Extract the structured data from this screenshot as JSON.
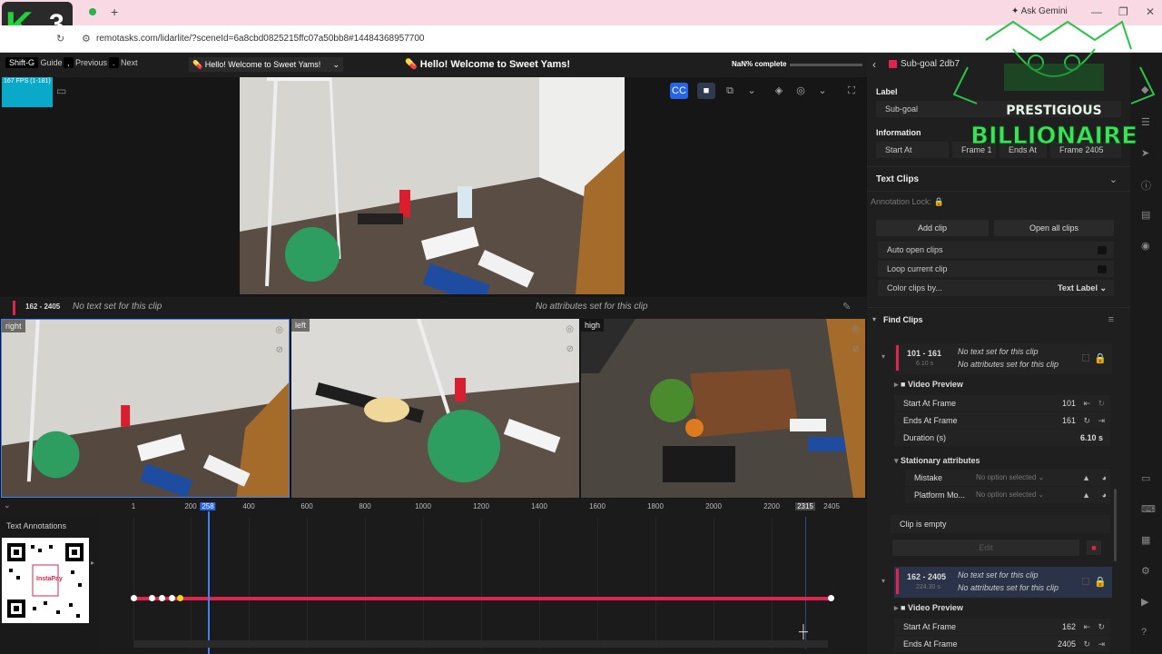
{
  "browser": {
    "url": "remotasks.com/lidarlite/?sceneId=6a8cbd0825215ffc07a50bb8#14484368957700",
    "ask_gemini": "Ask Gemini",
    "new_tab": "+",
    "logo_number": "3"
  },
  "topbar": {
    "shortcut_key": "Shift-G",
    "guide": "Guide",
    "previous": "Previous",
    "next": "Next",
    "task_title_small": "Hello! Welcome to Sweet Yams!",
    "task_title": "Hello! Welcome to Sweet Yams!",
    "progress": "NaN% complete"
  },
  "fps": "167 FPS (1-181)",
  "clip_bar": {
    "range": "162 - 2405",
    "text_status": "No text set for this clip",
    "attr_status": "No attributes set for this clip"
  },
  "cameras": [
    {
      "label": "right"
    },
    {
      "label": "left"
    },
    {
      "label": "high"
    }
  ],
  "timeline": {
    "section_label": "Text Annotations",
    "ticks": [
      "1",
      "200",
      "258",
      "400",
      "600",
      "800",
      "1000",
      "1200",
      "1400",
      "1600",
      "1800",
      "2000",
      "2200",
      "2315",
      "2405"
    ],
    "current_frame": "258",
    "end_marker": "2315"
  },
  "panel": {
    "header_title": "Sub-goal 2db7",
    "label_heading": "Label",
    "label_value": "Sub-goal",
    "info_heading": "Information",
    "start_at": "Start At",
    "start_frame": "Frame 1",
    "ends_at": "Ends At",
    "end_frame": "Frame 2405",
    "text_clips": "Text Clips",
    "annotation_lock": "Annotation Lock:",
    "add_clip": "Add clip",
    "open_all_clips": "Open all clips",
    "auto_open": "Auto open clips",
    "loop_current": "Loop current clip",
    "color_clips_by": "Color clips by...",
    "color_value": "Text Label",
    "find_clips": "Find Clips",
    "clip1": {
      "range": "101 - 161",
      "duration": "6.10 s",
      "no_text": "No text set for this clip",
      "no_attr": "No attributes set for this clip",
      "video_preview": "Video Preview",
      "start_label": "Start At Frame",
      "start_val": "101",
      "end_label": "Ends At Frame",
      "end_val": "161",
      "dur_label": "Duration (s)",
      "dur_val": "6.10 s",
      "stationary": "Stationary attributes",
      "mistake": "Mistake",
      "platform": "Platform Mo...",
      "no_option": "No option selected",
      "empty": "Clip is empty",
      "edit": "Edit"
    },
    "clip2": {
      "range": "162 - 2405",
      "duration": "224.30 s",
      "no_text": "No text set for this clip",
      "no_attr": "No attributes set for this clip",
      "video_preview": "Video Preview",
      "start_label": "Start At Frame",
      "start_val": "162",
      "end_label": "Ends At Frame",
      "end_val": "2405"
    }
  },
  "overlay": {
    "line1": "PRESTIGIOUS",
    "line2": "BILLIONAIRE"
  },
  "qr_text": "InstaPay",
  "colors": {
    "accent": "#e0244d",
    "playhead": "#3b82f6",
    "browser_tab_bg": "#f9d9e4"
  }
}
